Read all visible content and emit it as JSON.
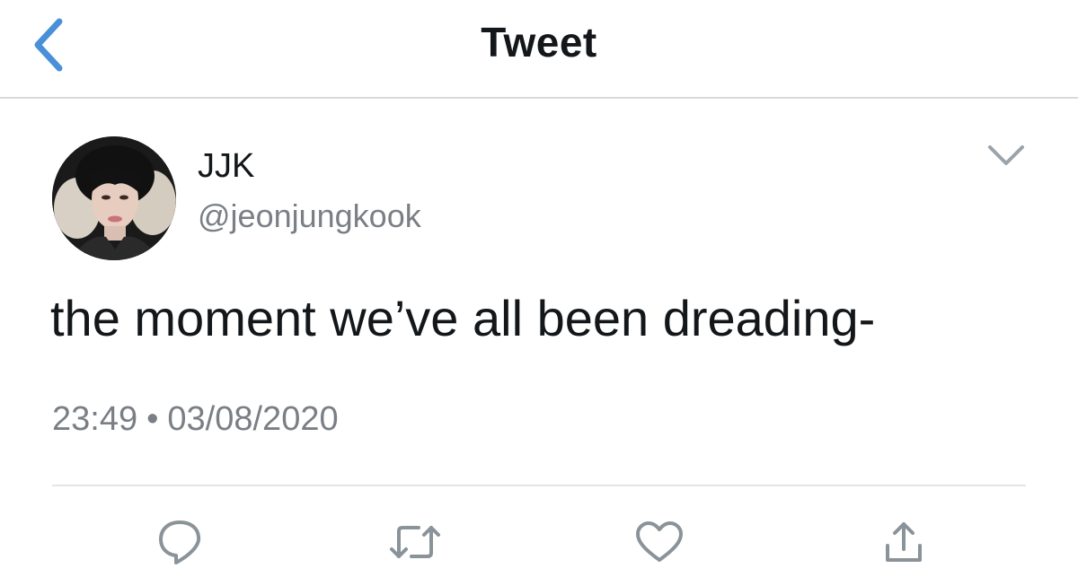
{
  "nav": {
    "title": "Tweet",
    "back_icon": "chevron-left-icon",
    "accent_color": "#4a90d9"
  },
  "tweet": {
    "author": {
      "display_name": "JJK",
      "handle": "@jeonjungkook"
    },
    "text": "the moment we’ve all been dreading-",
    "time": "23:49",
    "separator": "•",
    "date": "03/08/2020"
  },
  "actions": [
    {
      "name": "reply",
      "icon": "reply-icon"
    },
    {
      "name": "retweet",
      "icon": "retweet-icon"
    },
    {
      "name": "like",
      "icon": "heart-icon"
    },
    {
      "name": "share",
      "icon": "share-icon"
    }
  ],
  "colors": {
    "text": "#14171a",
    "secondary": "#7a7f85",
    "icon": "#8a9399",
    "divider": "#e1e5e8"
  }
}
